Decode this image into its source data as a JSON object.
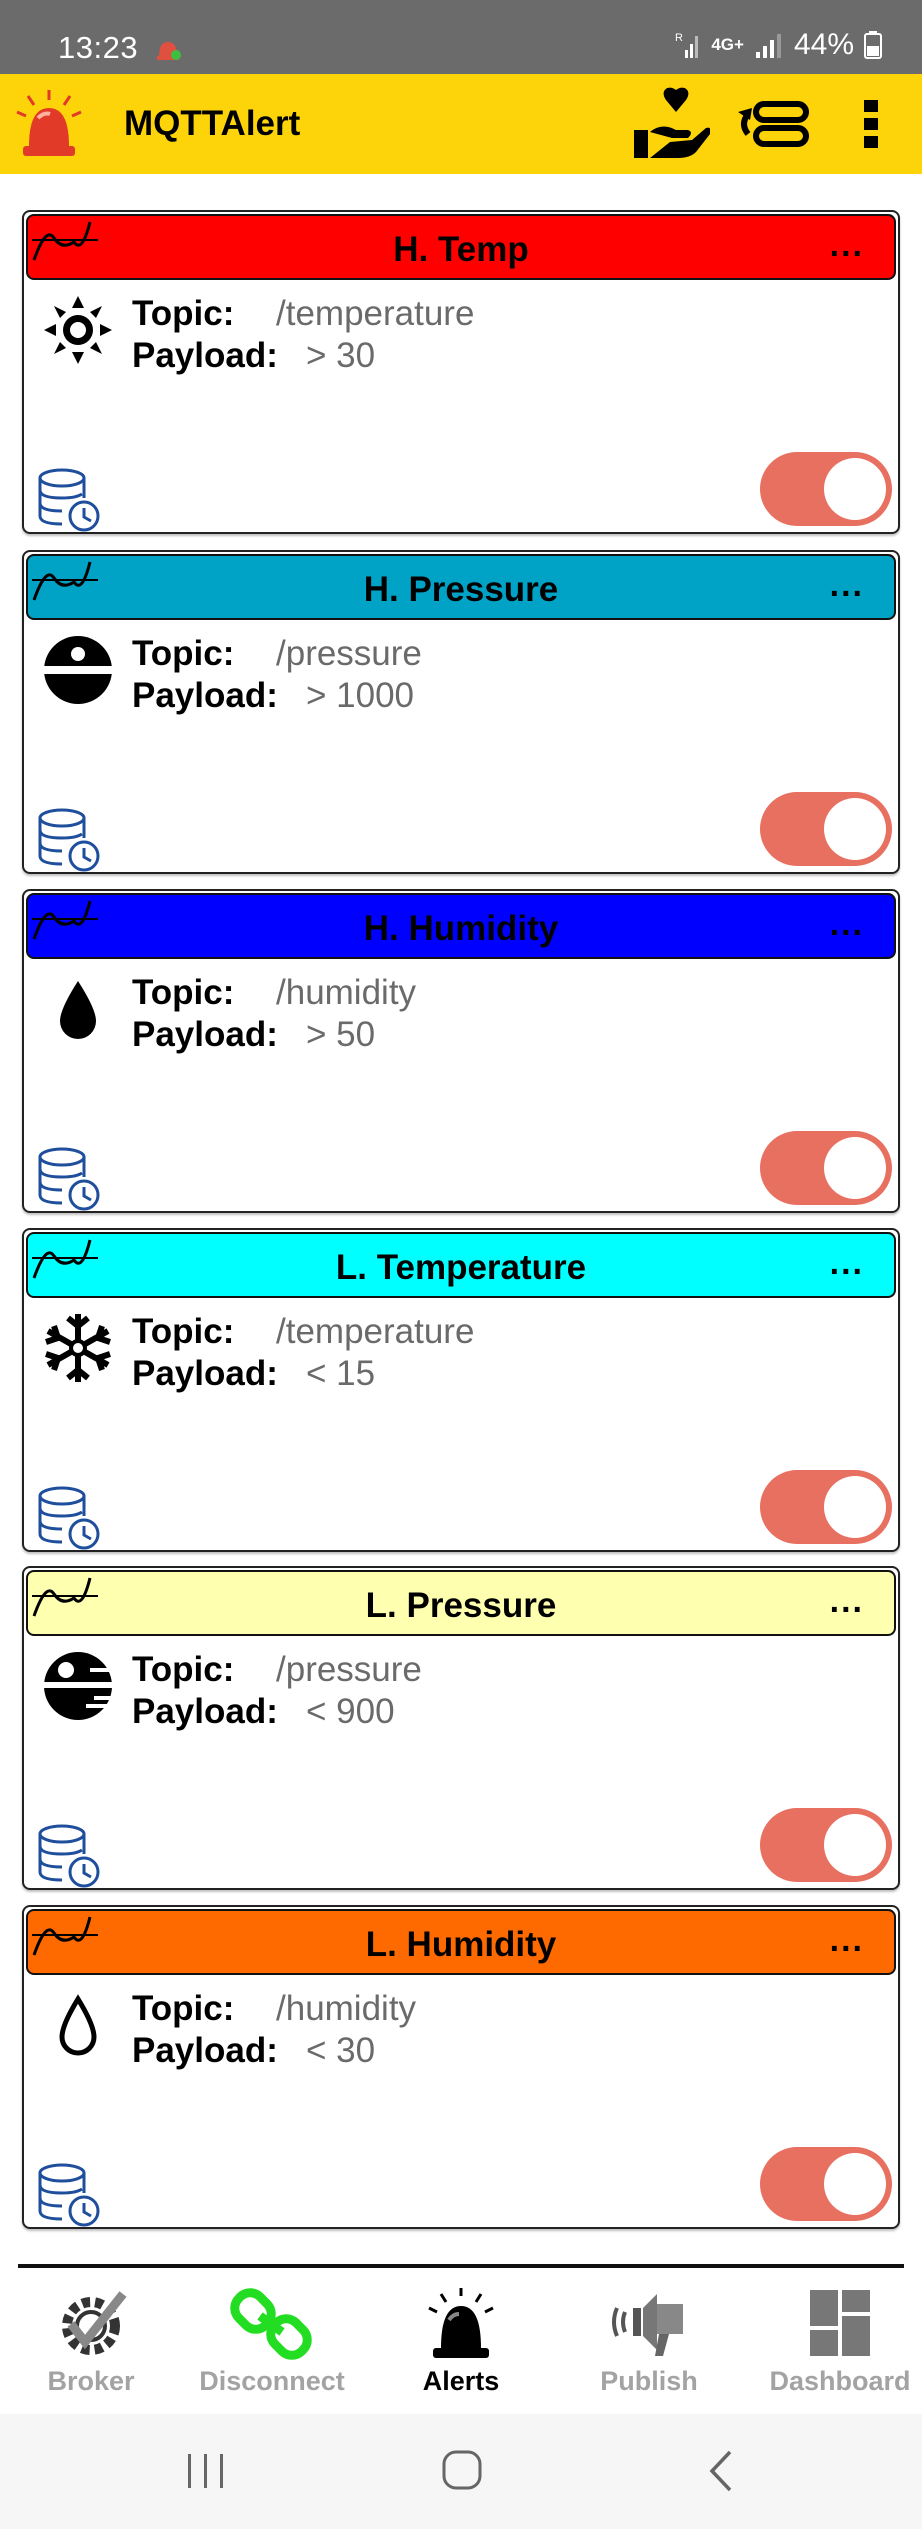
{
  "status_bar": {
    "time": "13:23",
    "network": "4G+",
    "battery": "44%"
  },
  "app_bar": {
    "title": "MQTTAlert",
    "icons": [
      "siren-icon",
      "donate-heart-icon",
      "sync-icon",
      "more-vert-icon"
    ]
  },
  "labels": {
    "topic": "Topic:",
    "payload": "Payload:",
    "menu": "..."
  },
  "alerts": [
    {
      "title": "H. Temp",
      "color": "#ff0000",
      "icon": "sun-icon",
      "topic": "/temperature",
      "payload": "> 30",
      "enabled": true
    },
    {
      "title": "H. Pressure",
      "color": "#00a2c6",
      "icon": "pressure-high-icon",
      "topic": "/pressure",
      "payload": "> 1000",
      "enabled": true
    },
    {
      "title": "H. Humidity",
      "color": "#0000ff",
      "icon": "drop-filled-icon",
      "topic": "/humidity",
      "payload": "> 50",
      "enabled": true
    },
    {
      "title": "L. Temperature",
      "color": "#00ffff",
      "icon": "snowflake-icon",
      "topic": "/temperature",
      "payload": "< 15",
      "enabled": true
    },
    {
      "title": "L. Pressure",
      "color": "#ffffb0",
      "icon": "pressure-low-icon",
      "topic": "/pressure",
      "payload": "< 900",
      "enabled": true
    },
    {
      "title": "L. Humidity",
      "color": "#ff6a00",
      "icon": "drop-outline-icon",
      "topic": "/humidity",
      "payload": "< 30",
      "enabled": true
    }
  ],
  "bottom_nav": {
    "broker": "Broker",
    "disconnect": "Disconnect",
    "alerts": "Alerts",
    "publish": "Publish",
    "dashboard": "Dashboard",
    "active": "Alerts"
  },
  "colors": {
    "app_bar": "#fdd40a",
    "toggle_on": "#e87060",
    "db_icon": "#1e4e9c",
    "disconnect_icon": "#22dd22"
  }
}
